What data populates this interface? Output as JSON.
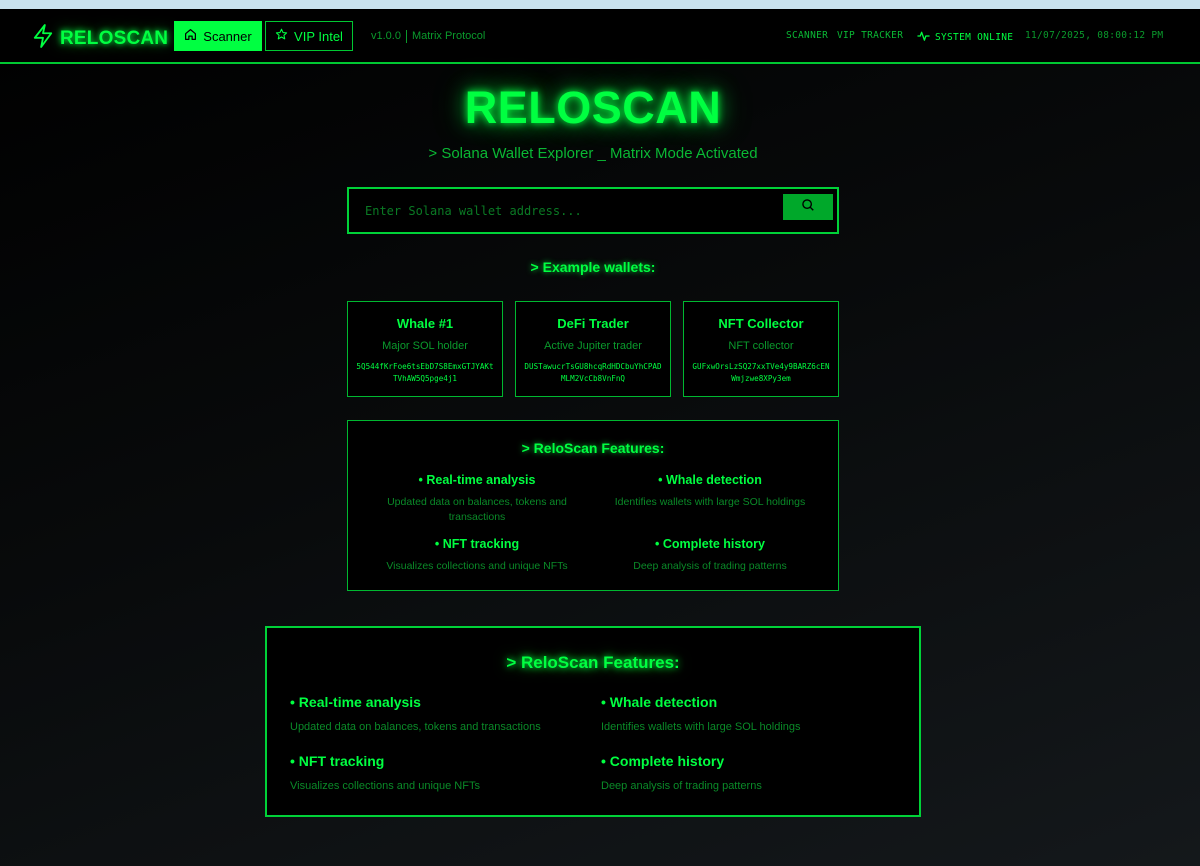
{
  "header": {
    "brand": "RELOSCAN",
    "tabs": {
      "scanner": "Scanner",
      "vip": "VIP Intel"
    },
    "version": "v1.0.0",
    "protocol": "Matrix Protocol",
    "nav": {
      "scanner": "SCANNER",
      "vip_tracker": "VIP TRACKER"
    },
    "status": "SYSTEM ONLINE",
    "datetime": "11/07/2025, 08:00:12 PM"
  },
  "hero": {
    "title": "RELOSCAN",
    "subtitle": "> Solana Wallet Explorer _ Matrix Mode Activated"
  },
  "search": {
    "placeholder": "Enter Solana wallet address...",
    "value": ""
  },
  "examples": {
    "title": "> Example wallets:",
    "wallets": [
      {
        "name": "Whale #1",
        "desc": "Major SOL holder",
        "address": "5Q544fKrFoe6tsEbD7S8EmxGTJYAKtTVhAW5Q5pge4j1"
      },
      {
        "name": "DeFi Trader",
        "desc": "Active Jupiter trader",
        "address": "DUSTawucrTsGU8hcqRdHDCbuYhCPADMLM2VcCb8VnFnQ"
      },
      {
        "name": "NFT Collector",
        "desc": "NFT collector",
        "address": "GUFxwOrsLzSQ27xxTVe4y9BARZ6cENWmjzwe8XPy3em"
      }
    ]
  },
  "features_small": {
    "title": "> ReloScan Features:",
    "items": [
      {
        "title": "• Real-time analysis",
        "desc": "Updated data on balances, tokens and transactions"
      },
      {
        "title": "• Whale detection",
        "desc": "Identifies wallets with large SOL holdings"
      },
      {
        "title": "• NFT tracking",
        "desc": "Visualizes collections and unique NFTs"
      },
      {
        "title": "• Complete history",
        "desc": "Deep analysis of trading patterns"
      }
    ]
  },
  "features_large": {
    "title": "> ReloScan Features:",
    "items": [
      {
        "title": "• Real-time analysis",
        "desc": "Updated data on balances, tokens and transactions"
      },
      {
        "title": "• Whale detection",
        "desc": "Identifies wallets with large SOL holdings"
      },
      {
        "title": "• NFT tracking",
        "desc": "Visualizes collections and unique NFTs"
      },
      {
        "title": "• Complete history",
        "desc": "Deep analysis of trading patterns"
      }
    ]
  },
  "icons": {
    "logo": "lightning-bolt-icon",
    "scanner_tab": "home-icon",
    "vip_tab": "star-icon",
    "status": "activity-pulse-icon",
    "search": "search-icon"
  },
  "colors": {
    "accent": "#00ff41",
    "accent_dim": "#0a9a2c",
    "background": "#000000"
  }
}
